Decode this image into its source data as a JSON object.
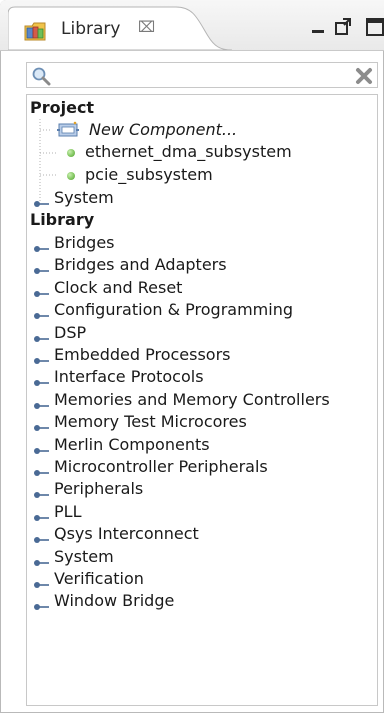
{
  "tab": {
    "title": "Library",
    "close_symbol": "⌧",
    "icon": "library-book-icon"
  },
  "window_controls": [
    "minimize-icon",
    "maximize-icon",
    "view-menu-icon"
  ],
  "search": {
    "value": "",
    "placeholder": "",
    "icon": "search-icon",
    "clear_icon": "clear-icon"
  },
  "tree": {
    "project_heading": "Project",
    "project_items": [
      {
        "label": "New Component...",
        "icon": "new-component-icon"
      },
      {
        "label": "ethernet_dma_subsystem",
        "icon": "green-dot-icon"
      },
      {
        "label": "pcie_subsystem",
        "icon": "green-dot-icon"
      }
    ],
    "project_system": "System",
    "library_heading": "Library",
    "library_items": [
      "Bridges",
      "Bridges and Adapters",
      "Clock and Reset",
      "Configuration & Programming",
      "DSP",
      "Embedded Processors",
      "Interface Protocols",
      "Memories and Memory Controllers",
      "Memory Test Microcores",
      "Merlin Components",
      "Microcontroller Peripherals",
      "Peripherals",
      "PLL",
      "Qsys Interconnect",
      "System",
      "Verification",
      "Window Bridge"
    ]
  }
}
